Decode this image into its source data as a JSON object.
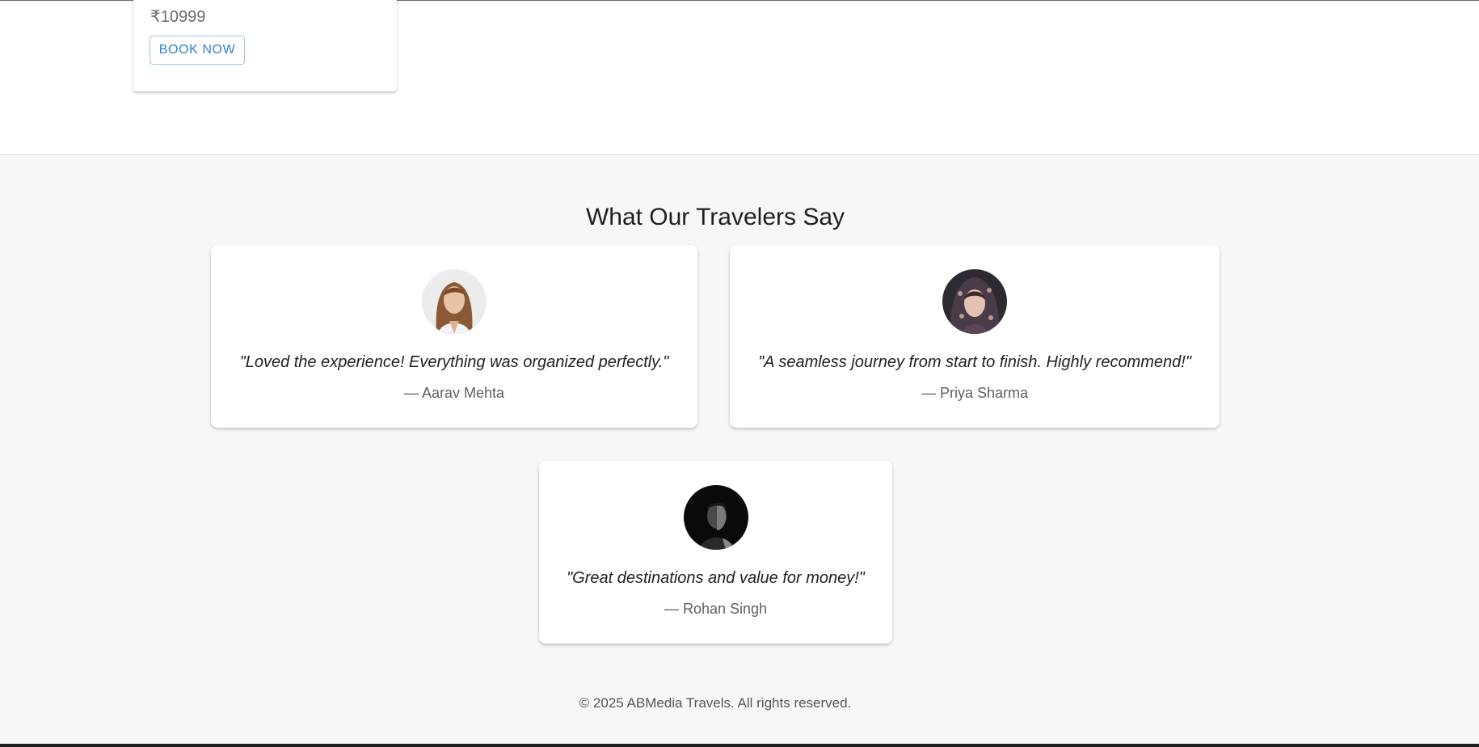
{
  "package": {
    "price": "₹10999",
    "book_label": "BOOK NOW"
  },
  "testimonials": {
    "title": "What Our Travelers Say",
    "items": [
      {
        "quote": "\"Loved the experience! Everything was organized perfectly.\"",
        "author": "— Aarav Mehta"
      },
      {
        "quote": "\"A seamless journey from start to finish. Highly recommend!\"",
        "author": "— Priya Sharma"
      },
      {
        "quote": "\"Great destinations and value for money!\"",
        "author": "— Rohan Singh"
      }
    ]
  },
  "footer": {
    "copyright": "© 2025 ABMedia Travels. All rights reserved."
  },
  "colors": {
    "accent": "#2f82d2",
    "section_bg": "#f7f7f7"
  }
}
